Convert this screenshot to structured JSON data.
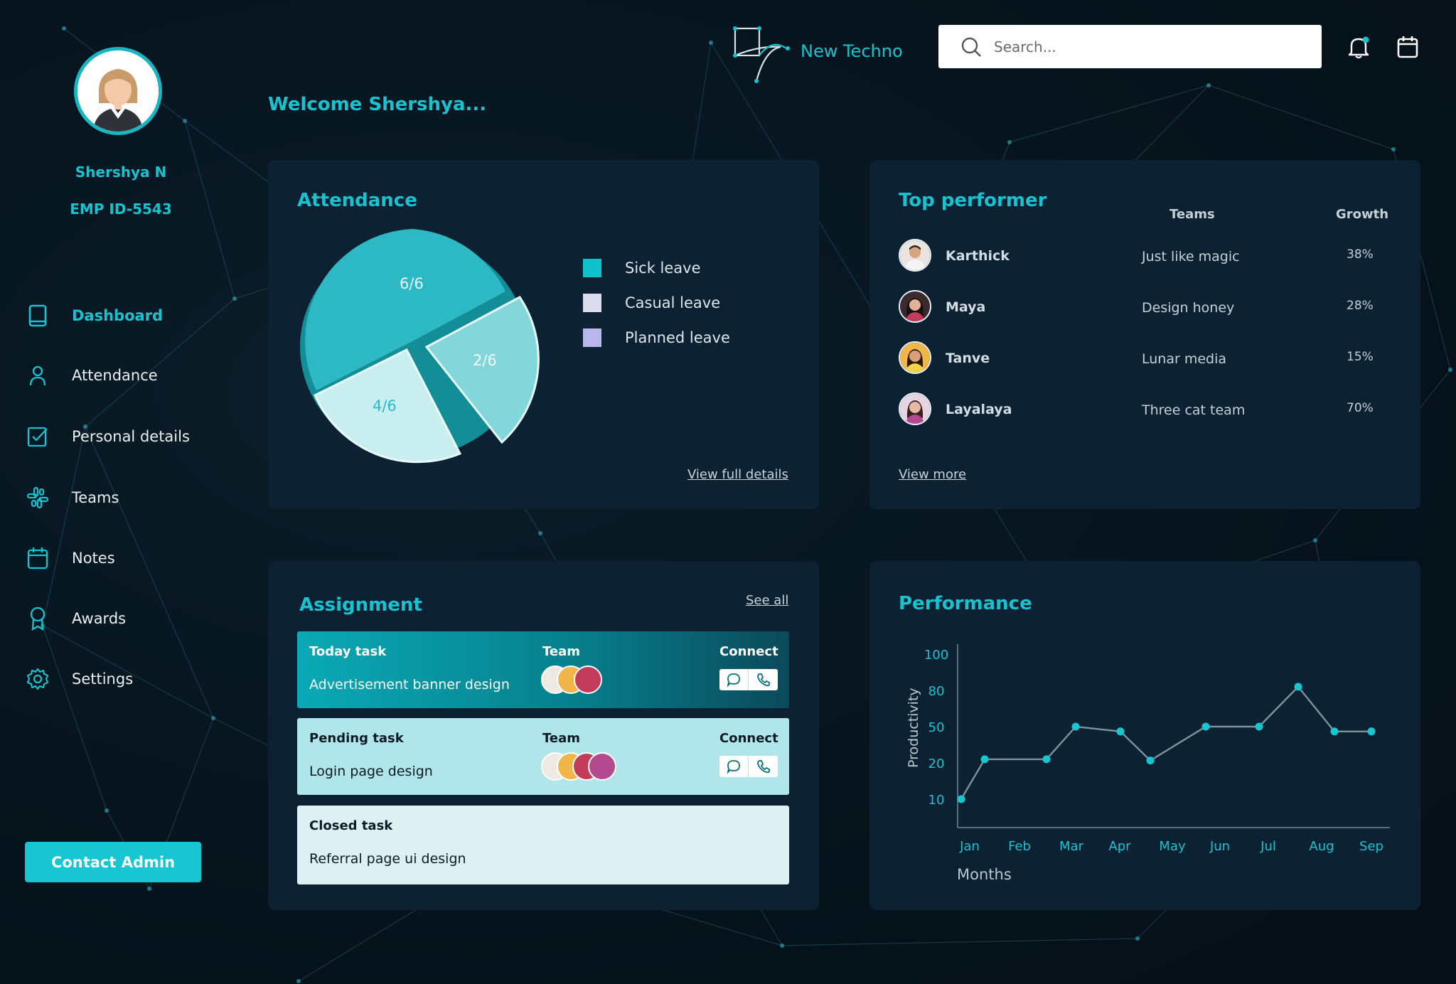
{
  "profile": {
    "name": "Shershya N",
    "emp_id": "EMP ID-5543"
  },
  "nav": [
    {
      "label": "Dashboard",
      "icon": "book-icon",
      "active": true
    },
    {
      "label": "Attendance",
      "icon": "user-icon",
      "active": false
    },
    {
      "label": "Personal details",
      "icon": "checkbox-icon",
      "active": false
    },
    {
      "label": "Teams",
      "icon": "slack-icon",
      "active": false
    },
    {
      "label": "Notes",
      "icon": "calendar-icon",
      "active": false
    },
    {
      "label": "Awards",
      "icon": "award-icon",
      "active": false
    },
    {
      "label": "Settings",
      "icon": "gear-icon",
      "active": false
    }
  ],
  "contact_admin": "Contact Admin",
  "header": {
    "brand": "New Techno",
    "search_placeholder": "Search...",
    "welcome": "Welcome Shershya..."
  },
  "colors": {
    "accent": "#19c2cf",
    "card": "#0c2233",
    "sick": "#0fc3cd",
    "casual": "#dcdcef",
    "planned": "#b9b6ea"
  },
  "attendance": {
    "title": "Attendance",
    "slices": [
      {
        "label": "6/6",
        "value": 6
      },
      {
        "label": "2/6",
        "value": 2
      },
      {
        "label": "4/6",
        "value": 4
      }
    ],
    "legend": [
      "Sick leave",
      "Casual leave",
      "Planned leave"
    ],
    "link": "View full details"
  },
  "top_performer": {
    "title": "Top performer",
    "col_teams": "Teams",
    "col_growth": "Growth",
    "rows": [
      {
        "name": "Karthick",
        "team": "Just like magic",
        "growth": "38%"
      },
      {
        "name": "Maya",
        "team": "Design honey",
        "growth": "28%"
      },
      {
        "name": "Tanve",
        "team": "Lunar media",
        "growth": "15%"
      },
      {
        "name": "Layalaya",
        "team": "Three cat team",
        "growth": "70%"
      }
    ],
    "link": "View more"
  },
  "assignment": {
    "title": "Assignment",
    "link": "See all",
    "tasks": [
      {
        "title": "Today task",
        "desc": "Advertisement banner design",
        "team_label": "Team",
        "connect_label": "Connect"
      },
      {
        "title": "Pending task",
        "desc": "Login page design",
        "team_label": "Team",
        "connect_label": "Connect"
      },
      {
        "title": "Closed task",
        "desc": "Referral page ui design"
      }
    ]
  },
  "chart_data": {
    "type": "line",
    "title": "Performance",
    "xlabel": "Months",
    "ylabel": "Productivity",
    "y_ticks": [
      "10",
      "20",
      "50",
      "80",
      "100"
    ],
    "categories": [
      "Jan",
      "Feb",
      "Mar",
      "Apr",
      "May",
      "Jun",
      "Jul",
      "Aug",
      "Sep"
    ],
    "series": [
      {
        "points": [
          {
            "x": "Jan",
            "y": 10
          },
          {
            "x": "Jan–Feb",
            "y": 23
          },
          {
            "x": "Feb–Mar",
            "y": 23
          },
          {
            "x": "Mar",
            "y": 50
          },
          {
            "x": "Apr",
            "y": 46
          },
          {
            "x": "Apr–May",
            "y": 22
          },
          {
            "x": "Jun",
            "y": 50
          },
          {
            "x": "Jul",
            "y": 50
          },
          {
            "x": "Jul–Aug",
            "y": 82
          },
          {
            "x": "Aug",
            "y": 46
          },
          {
            "x": "Sep",
            "y": 46
          }
        ]
      }
    ],
    "grid": false
  }
}
